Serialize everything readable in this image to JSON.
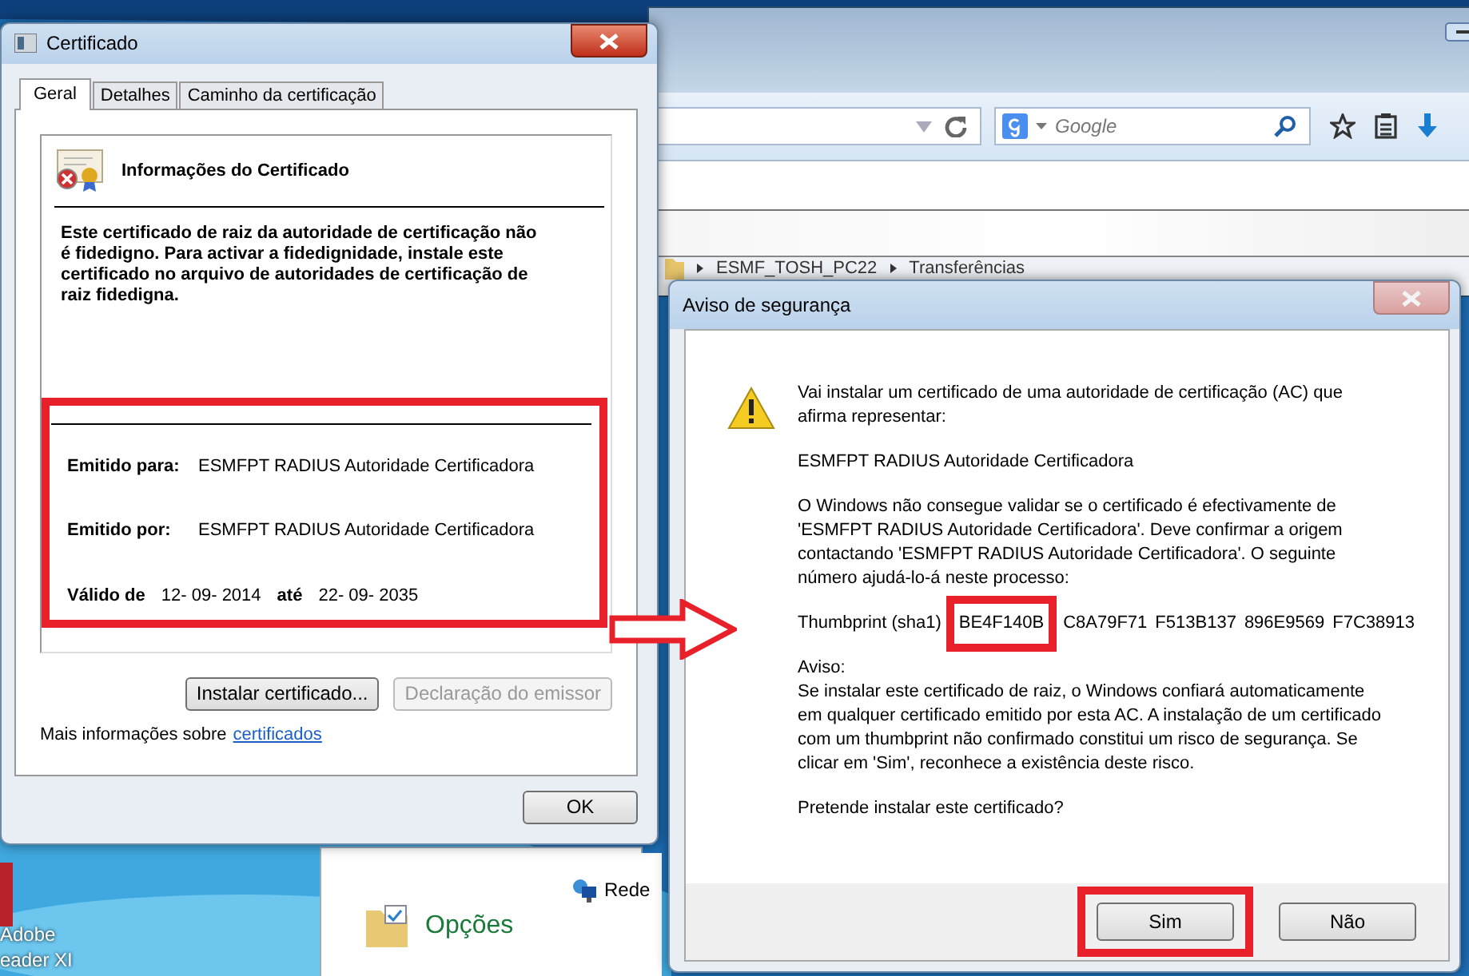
{
  "browser": {
    "search_placeholder": "Google",
    "breadcrumb": [
      "ESMF_TOSH_PC22",
      "Transferências"
    ]
  },
  "desktop": {
    "icon_label": [
      "Adobe",
      "eader XI"
    ]
  },
  "explorer": {
    "nav_item": "Rede",
    "option": "Opções"
  },
  "certificate_dialog": {
    "title": "Certificado",
    "tabs": [
      {
        "label": "Geral",
        "selected": true
      },
      {
        "label": "Detalhes",
        "selected": false
      },
      {
        "label": "Caminho da certificação",
        "selected": false
      }
    ],
    "heading": "Informações do Certificado",
    "message": "Este certificado de raiz da autoridade de certificação não é fidedigno. Para activar a fidedignidade, instale este certificado no arquivo de autoridades de certificação de raiz fidedigna.",
    "details_highlighted": true,
    "fields": [
      {
        "label": "Emitido para:",
        "value": "ESMFPT RADIUS Autoridade Certificadora"
      },
      {
        "label": "Emitido por:",
        "value": "ESMFPT RADIUS Autoridade Certificadora"
      }
    ],
    "validity": {
      "from_label": "Válido de",
      "from": "12- 09- 2014",
      "to_label": "até",
      "to": "22- 09- 2035"
    },
    "buttons": [
      {
        "label": "Instalar certificado...",
        "disabled": false
      },
      {
        "label": "Declaração do emissor",
        "disabled": true
      }
    ],
    "info_text": "Mais informações sobre",
    "info_link": "certificados",
    "ok": "OK"
  },
  "security_dialog": {
    "title": "Aviso de segurança",
    "intro": "Vai instalar um certificado de uma autoridade de certificação (AC) que afirma representar:",
    "authority": "ESMFPT RADIUS Autoridade Certificadora",
    "explanation": "O Windows não consegue validar se o certificado é efectivamente de 'ESMFPT RADIUS Autoridade Certificadora'. Deve confirmar a origem contactando 'ESMFPT RADIUS Autoridade Certificadora'. O seguinte número ajudá-lo-á neste processo:",
    "thumbprint_label": "Thumbprint (sha1)",
    "thumbprint": [
      {
        "text": "BE4F140B",
        "highlighted": true
      },
      {
        "text": "C8A79F71",
        "highlighted": false
      },
      {
        "text": "F513B137",
        "highlighted": false
      },
      {
        "text": "896E9569",
        "highlighted": false
      },
      {
        "text": "F7C38913",
        "highlighted": false
      }
    ],
    "warning_title": "Aviso:",
    "warning": "Se instalar este certificado de raiz, o Windows confiará automaticamente em qualquer certificado emitido por esta AC. A instalação de um certificado com um thumbprint não confirmado constitui um risco de segurança. Se clicar em 'Sim', reconhece a existência deste risco.",
    "question": "Pretende instalar este certificado?",
    "buttons": [
      {
        "label": "Sim",
        "highlighted": true
      },
      {
        "label": "Não",
        "highlighted": false
      }
    ]
  }
}
